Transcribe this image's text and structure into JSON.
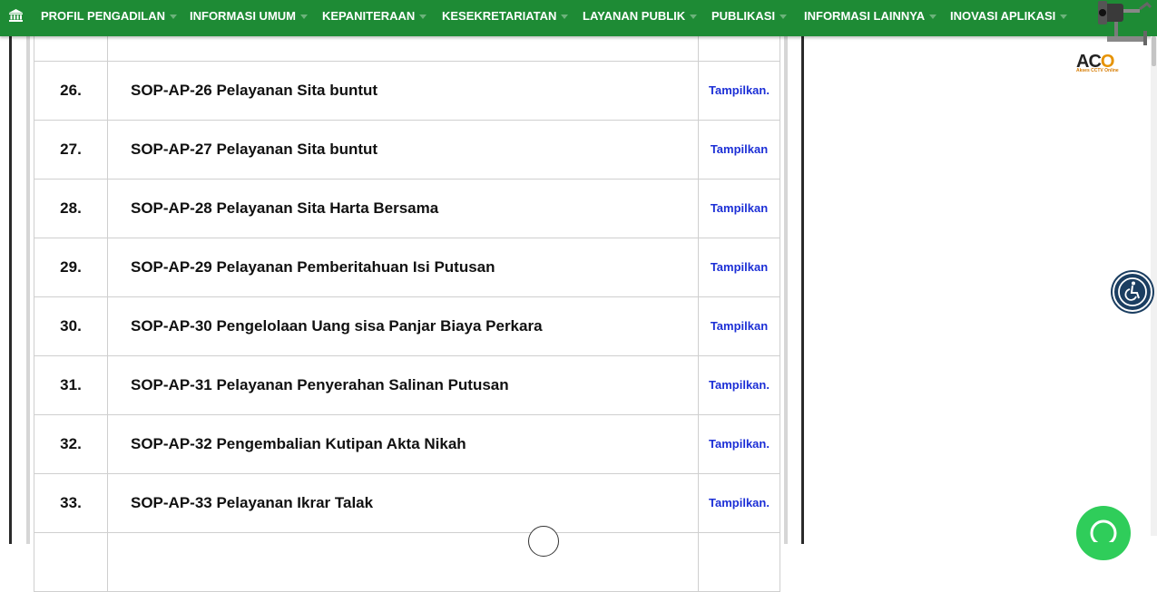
{
  "nav": {
    "items": [
      {
        "label": "PROFIL PENGADILAN"
      },
      {
        "label": "INFORMASI UMUM"
      },
      {
        "label": "KEPANITERAAN"
      },
      {
        "label": "KESEKRETARIATAN"
      },
      {
        "label": "LAYANAN PUBLIK"
      },
      {
        "label": "PUBLIKASI"
      },
      {
        "label": "INFORMASI LAINNYA"
      },
      {
        "label": "INOVASI APLIKASI"
      }
    ]
  },
  "cctv": {
    "logo_a": "AC",
    "logo_o": "O",
    "sub": "Akses CCTV Online"
  },
  "table": {
    "rows": [
      {
        "num": "26.",
        "title": "SOP-AP-26 Pelayanan Sita buntut",
        "action": "Tampilkan."
      },
      {
        "num": "27.",
        "title": "SOP-AP-27 Pelayanan Sita buntut",
        "action": "Tampilkan"
      },
      {
        "num": "28.",
        "title": "SOP-AP-28 Pelayanan Sita Harta Bersama",
        "action": "Tampilkan"
      },
      {
        "num": "29.",
        "title": "SOP-AP-29 Pelayanan Pemberitahuan Isi Putusan",
        "action": "Tampilkan"
      },
      {
        "num": "30.",
        "title": "SOP-AP-30 Pengelolaan Uang sisa Panjar Biaya Perkara",
        "action": "Tampilkan"
      },
      {
        "num": "31.",
        "title": "SOP-AP-31 Pelayanan Penyerahan Salinan Putusan",
        "action": "Tampilkan."
      },
      {
        "num": "32.",
        "title": "SOP-AP-32 Pengembalian Kutipan Akta Nikah",
        "action": "Tampilkan."
      },
      {
        "num": "33.",
        "title": "SOP-AP-33 Pelayanan Ikrar Talak",
        "action": "Tampilkan."
      }
    ]
  },
  "colors": {
    "navbar": "#1e8b35",
    "link": "#1c2fd6",
    "accessibility": "#1b3e61",
    "whatsapp": "#2fcd5a"
  }
}
